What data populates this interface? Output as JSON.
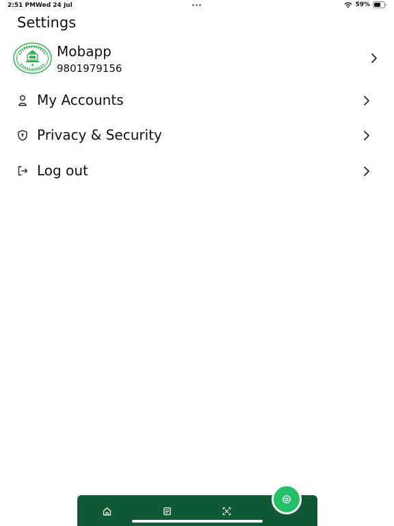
{
  "status_bar": {
    "time": "2:51 PM",
    "date": "Wed 24 Jul",
    "battery": "59%"
  },
  "header": {
    "title": "Settings"
  },
  "profile": {
    "name": "Mobapp",
    "phone": "9801979156",
    "avatar_icon": "emblem-logo"
  },
  "menu": {
    "items": [
      {
        "label": "My Accounts",
        "icon": "user-icon"
      },
      {
        "label": "Privacy & Security",
        "icon": "shield-icon"
      },
      {
        "label": "Log out",
        "icon": "logout-icon"
      }
    ]
  },
  "tab_bar": {
    "tabs": [
      {
        "icon": "home-icon"
      },
      {
        "icon": "document-icon"
      },
      {
        "icon": "scan-icon"
      },
      {
        "icon": "gear-icon",
        "active": true
      }
    ]
  },
  "colors": {
    "tab_bar_bg": "#0f5a35",
    "fab_bg": "#23c06a",
    "logo_green": "#2db34a"
  }
}
